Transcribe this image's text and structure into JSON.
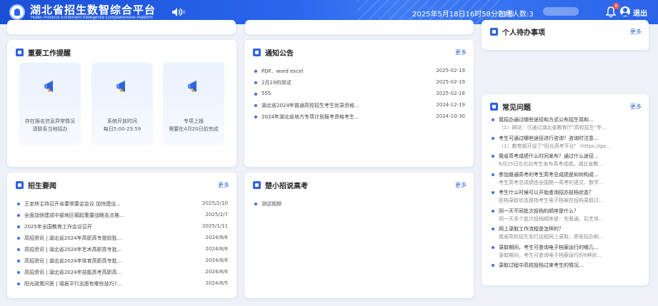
{
  "header": {
    "title": "湖北省招生数智综合平台",
    "subtitle": "Hubei Province Enrollment Intelligence Comprehensive Platform",
    "speaker_sub": "))",
    "datetime": "2025年5月18日16时58分21秒",
    "online_label": "在线人数:3",
    "notification_count": "6",
    "logout_label": "退出"
  },
  "important_reminders": {
    "title": "重要工作提醒",
    "tiles": [
      {
        "line1": "存在报名信息异常情况",
        "line2": "请联系当地招办"
      },
      {
        "line1": "系统开放时间",
        "line2": "每日5:00-23:59"
      },
      {
        "line1": "专项上报",
        "line2": "需要在4月20日前完成"
      }
    ]
  },
  "notices": {
    "title": "通知公告",
    "more": "更多",
    "items": [
      {
        "text": "PDF、word excel",
        "date": "2025-02-19"
      },
      {
        "text": "2月19的测试",
        "date": "2025-02-19"
      },
      {
        "text": "555",
        "date": "2025-02-18"
      },
      {
        "text": "湖北省2024年普通高校招生考生优录资格...",
        "date": "2024-12-19"
      },
      {
        "text": "2024年湖北省地方专项计划报考资格考生...",
        "date": "2024-10-30"
      }
    ]
  },
  "todo": {
    "title": "个人待办事项",
    "more": "更多"
  },
  "faq": {
    "title": "常见问题",
    "more": "更多",
    "items": [
      {
        "q": "我招办通过哪些途径和方式公布招生简和...",
        "a": "（1）网站：可通过湖北省教育厅\"高校招生\"专..."
      },
      {
        "q": "考生可通过哪些途径进行咨询？咨询时注意...",
        "a": "（1）教育部开设了\"阳光高考平台\"（https://ga..."
      },
      {
        "q": "我省高考成绩什么时间发布？通过什么途径...",
        "a": "6月25日左右向考生发布高考成绩。湖北省教..."
      },
      {
        "q": "参加普通高考的考生高考总成绩是如何构成...",
        "a": "考生高考总成绩由全国统一高考的语文、数学..."
      },
      {
        "q": "考生什么时候可以开始查询招办投档状态？",
        "a": "投档录取状态是指考生电子档案在投档录取过..."
      },
      {
        "q": "同一天不同批次投档的顺序是什么？",
        "a": "同一天多个批次投档顺序是：先普通、后艺体..."
      },
      {
        "q": "网上录取工作流程是怎样的？",
        "a": "我省高校招生实行远程网上录取，即省招办和..."
      },
      {
        "q": "录取期间，考生可查询电子档案运行的哪几...",
        "a": "录取期间，考生可查询电子档案运行的6种状..."
      },
      {
        "q": "录取过程中高校投档过来考生的情况...",
        "a": ""
      }
    ]
  },
  "admission_news": {
    "title": "招生要闻",
    "more": "更多",
    "items": [
      {
        "text": "王忠林主持召开省委常委会会议 加快建设...",
        "date": "2025/2/10"
      },
      {
        "text": "全面加快建成中部地区崛起重要战略支点推...",
        "date": "2025/2/7"
      },
      {
        "text": "2025年全国教育工作会议召开",
        "date": "2025/1/11"
      },
      {
        "text": "高招资讯 | 湖北省2024年高职高专提前批...",
        "date": "2024/8/6"
      },
      {
        "text": "高招资讯 | 湖北省2024年艺术高职高专批...",
        "date": "2024/8/6"
      },
      {
        "text": "高招资讯 | 湖北省2024年体育高职高专批...",
        "date": "2024/8/6"
      },
      {
        "text": "高招资讯 | 湖北省2024年技能高考高职高...",
        "date": "2024/8/6"
      },
      {
        "text": "阳光政策问答 | 填报平行志愿有哪些技巧?...",
        "date": "2024/8/5"
      }
    ]
  },
  "chuxiao": {
    "title": "楚小招说高考",
    "more": "更多",
    "items": [
      {
        "text": "测试视频",
        "date": ""
      }
    ]
  },
  "colors": {
    "header_blue": "#2a63e8",
    "accent": "#3264d6",
    "badge_red": "#ff5252"
  }
}
